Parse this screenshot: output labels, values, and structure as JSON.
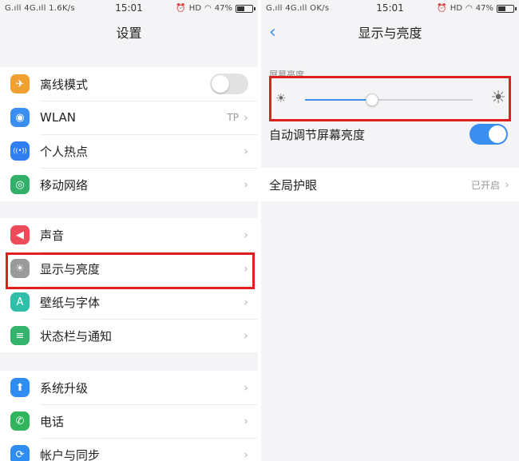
{
  "left": {
    "status": {
      "signal": "G.ıll 4G.ıll 1.6K/s",
      "time": "15:01",
      "hd": "HD",
      "battery": "47%"
    },
    "title": "设置",
    "groups": [
      [
        {
          "label": "离线模式",
          "icon": "airplane-icon",
          "glyph": "✈",
          "color": "#f0a030",
          "control": "toggle-off"
        },
        {
          "label": "WLAN",
          "icon": "wifi-icon",
          "glyph": "◉",
          "color": "#3a8ef0",
          "value": "TP"
        },
        {
          "label": "个人热点",
          "icon": "hotspot-icon",
          "glyph": "((•))",
          "color": "#2f7ff2"
        },
        {
          "label": "移动网络",
          "icon": "globe-icon",
          "glyph": "◎",
          "color": "#32b06a"
        }
      ],
      [
        {
          "label": "声音",
          "icon": "sound-icon",
          "glyph": "◀",
          "color": "#ee4b5a"
        },
        {
          "label": "显示与亮度",
          "icon": "brightness-icon",
          "glyph": "☀",
          "color": "#9a9a9a"
        },
        {
          "label": "壁纸与字体",
          "icon": "wallpaper-font-icon",
          "glyph": "A",
          "color": "#2fbfa8"
        },
        {
          "label": "状态栏与通知",
          "icon": "notification-icon",
          "glyph": "≡",
          "color": "#33b36b"
        }
      ],
      [
        {
          "label": "系统升级",
          "icon": "system-update-icon",
          "glyph": "⬆",
          "color": "#2f8cf0"
        },
        {
          "label": "电话",
          "icon": "phone-icon",
          "glyph": "✆",
          "color": "#30b45c"
        },
        {
          "label": "帐户与同步",
          "icon": "account-sync-icon",
          "glyph": "⟳",
          "color": "#2f8cf0"
        }
      ]
    ]
  },
  "right": {
    "status": {
      "signal": "G.ıll 4G.ıll OK/s",
      "time": "15:01",
      "hd": "HD",
      "battery": "47%"
    },
    "title": "显示与亮度",
    "section_label": "屏幕亮度",
    "brightness_level": 0.4,
    "auto_brightness": {
      "label": "自动调节屏幕亮度",
      "on": true
    },
    "eye_care": {
      "label": "全局护眼",
      "value": "已开启"
    }
  },
  "colors": {
    "accent": "#3a8ef0",
    "highlight": "#e02020"
  }
}
